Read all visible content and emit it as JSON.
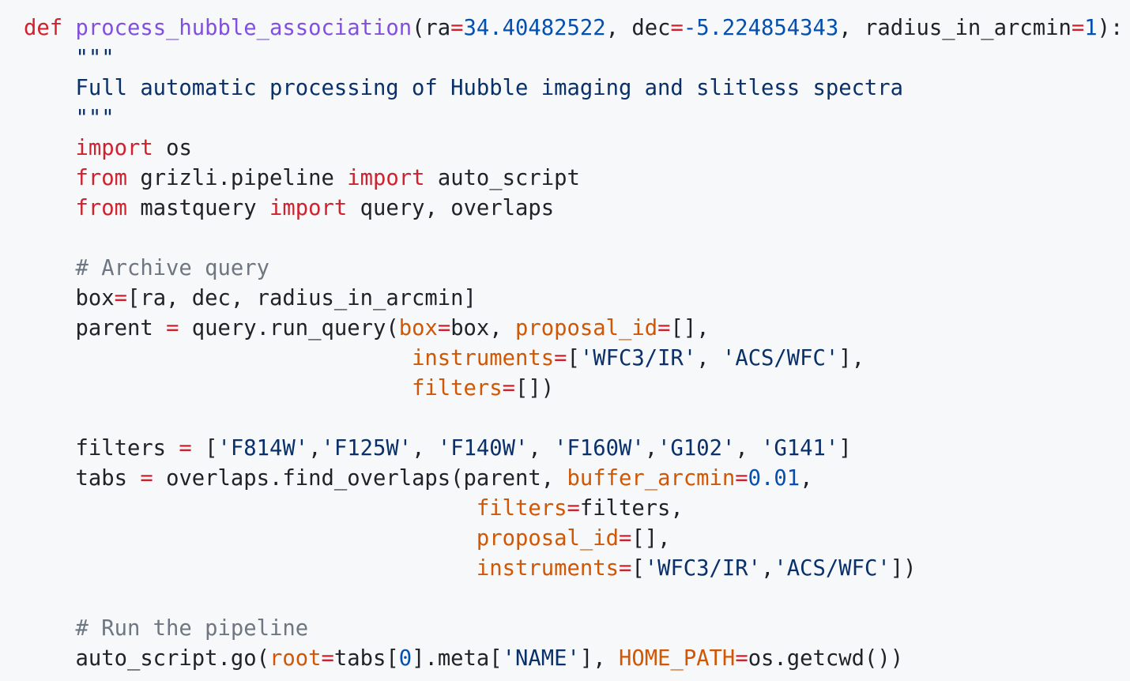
{
  "code": {
    "language": "python",
    "colors": {
      "background": "#f6f8fa",
      "keyword": "#cf222e",
      "function_name": "#8250df",
      "number": "#0550ae",
      "string": "#0a3069",
      "comment": "#6e7781",
      "parameter": "#d15704",
      "text": "#1f2328"
    },
    "lines": [
      [
        [
          "kw",
          "def"
        ],
        [
          "plain",
          " "
        ],
        [
          "fn",
          "process_hubble_association"
        ],
        [
          "plain",
          "(ra"
        ],
        [
          "op",
          "="
        ],
        [
          "num",
          "34.40482522"
        ],
        [
          "plain",
          ", dec"
        ],
        [
          "op",
          "="
        ],
        [
          "num",
          "-5.224854343"
        ],
        [
          "plain",
          ", radius_in_arcmin"
        ],
        [
          "op",
          "="
        ],
        [
          "num",
          "1"
        ],
        [
          "plain",
          "):"
        ]
      ],
      [
        [
          "doc",
          "    \"\"\""
        ]
      ],
      [
        [
          "doc",
          "    Full automatic processing of Hubble imaging and slitless spectra"
        ]
      ],
      [
        [
          "doc",
          "    \"\"\""
        ]
      ],
      [
        [
          "plain",
          "    "
        ],
        [
          "kw",
          "import"
        ],
        [
          "plain",
          " os"
        ]
      ],
      [
        [
          "plain",
          "    "
        ],
        [
          "kw",
          "from"
        ],
        [
          "plain",
          " grizli.pipeline "
        ],
        [
          "kw",
          "import"
        ],
        [
          "plain",
          " auto_script"
        ]
      ],
      [
        [
          "plain",
          "    "
        ],
        [
          "kw",
          "from"
        ],
        [
          "plain",
          " mastquery "
        ],
        [
          "kw",
          "import"
        ],
        [
          "plain",
          " query, overlaps"
        ]
      ],
      [
        [
          "plain",
          ""
        ]
      ],
      [
        [
          "cm",
          "    # Archive query"
        ]
      ],
      [
        [
          "plain",
          "    box"
        ],
        [
          "op",
          "="
        ],
        [
          "plain",
          "[ra, dec, radius_in_arcmin]"
        ]
      ],
      [
        [
          "plain",
          "    parent "
        ],
        [
          "op",
          "="
        ],
        [
          "plain",
          " query.run_query("
        ],
        [
          "param",
          "box"
        ],
        [
          "op",
          "="
        ],
        [
          "plain",
          "box, "
        ],
        [
          "param",
          "proposal_id"
        ],
        [
          "op",
          "="
        ],
        [
          "plain",
          "[],"
        ]
      ],
      [
        [
          "plain",
          "                              "
        ],
        [
          "param",
          "instruments"
        ],
        [
          "op",
          "="
        ],
        [
          "plain",
          "["
        ],
        [
          "str",
          "'WFC3/IR'"
        ],
        [
          "plain",
          ", "
        ],
        [
          "str",
          "'ACS/WFC'"
        ],
        [
          "plain",
          "],"
        ]
      ],
      [
        [
          "plain",
          "                              "
        ],
        [
          "param",
          "filters"
        ],
        [
          "op",
          "="
        ],
        [
          "plain",
          "[])"
        ]
      ],
      [
        [
          "plain",
          ""
        ]
      ],
      [
        [
          "plain",
          "    filters "
        ],
        [
          "op",
          "="
        ],
        [
          "plain",
          " ["
        ],
        [
          "str",
          "'F814W'"
        ],
        [
          "plain",
          ","
        ],
        [
          "str",
          "'F125W'"
        ],
        [
          "plain",
          ", "
        ],
        [
          "str",
          "'F140W'"
        ],
        [
          "plain",
          ", "
        ],
        [
          "str",
          "'F160W'"
        ],
        [
          "plain",
          ","
        ],
        [
          "str",
          "'G102'"
        ],
        [
          "plain",
          ", "
        ],
        [
          "str",
          "'G141'"
        ],
        [
          "plain",
          "]"
        ]
      ],
      [
        [
          "plain",
          "    tabs "
        ],
        [
          "op",
          "="
        ],
        [
          "plain",
          " overlaps.find_overlaps(parent, "
        ],
        [
          "param",
          "buffer_arcmin"
        ],
        [
          "op",
          "="
        ],
        [
          "num",
          "0.01"
        ],
        [
          "plain",
          ","
        ]
      ],
      [
        [
          "plain",
          "                                   "
        ],
        [
          "param",
          "filters"
        ],
        [
          "op",
          "="
        ],
        [
          "plain",
          "filters,"
        ]
      ],
      [
        [
          "plain",
          "                                   "
        ],
        [
          "param",
          "proposal_id"
        ],
        [
          "op",
          "="
        ],
        [
          "plain",
          "[],"
        ]
      ],
      [
        [
          "plain",
          "                                   "
        ],
        [
          "param",
          "instruments"
        ],
        [
          "op",
          "="
        ],
        [
          "plain",
          "["
        ],
        [
          "str",
          "'WFC3/IR'"
        ],
        [
          "plain",
          ","
        ],
        [
          "str",
          "'ACS/WFC'"
        ],
        [
          "plain",
          "])"
        ]
      ],
      [
        [
          "plain",
          ""
        ]
      ],
      [
        [
          "cm",
          "    # Run the pipeline"
        ]
      ],
      [
        [
          "plain",
          "    auto_script.go("
        ],
        [
          "param",
          "root"
        ],
        [
          "op",
          "="
        ],
        [
          "plain",
          "tabs["
        ],
        [
          "num",
          "0"
        ],
        [
          "plain",
          "].meta["
        ],
        [
          "str",
          "'NAME'"
        ],
        [
          "plain",
          "], "
        ],
        [
          "param",
          "HOME_PATH"
        ],
        [
          "op",
          "="
        ],
        [
          "plain",
          "os.getcwd())"
        ]
      ]
    ]
  }
}
